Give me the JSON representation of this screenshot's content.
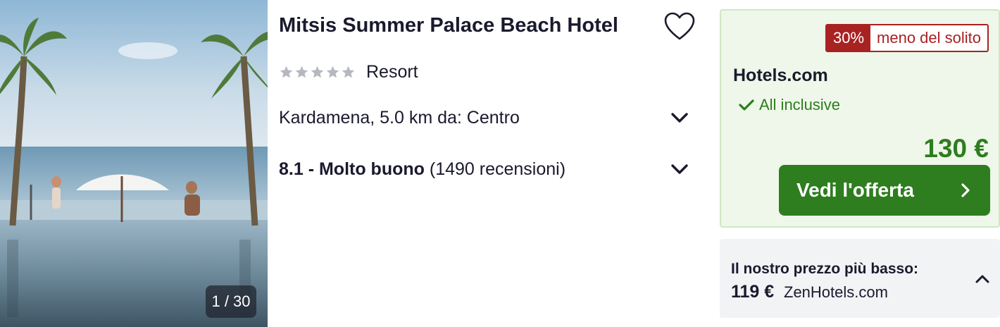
{
  "photo": {
    "counter": "1 / 30"
  },
  "hotel": {
    "name": "Mitsis Summer Palace Beach Hotel",
    "stars": 5,
    "type": "Resort",
    "location": "Kardamena, 5.0 km da: Centro",
    "rating_score": "8.1 - Molto buono",
    "rating_reviews": "(1490 recensioni)"
  },
  "deal": {
    "discount_pct": "30%",
    "discount_text": "meno del solito",
    "provider": "Hotels.com",
    "inclusion": "All inclusive",
    "price": "130 €",
    "cta_label": "Vedi l'offerta"
  },
  "lowest": {
    "label": "Il nostro prezzo più basso:",
    "price": "119 €",
    "site": "ZenHotels.com"
  },
  "colors": {
    "accent_green": "#2e7d1f",
    "discount_red": "#a82222",
    "deal_bg": "#eef7e9",
    "star_gray": "#b5b8bf"
  }
}
